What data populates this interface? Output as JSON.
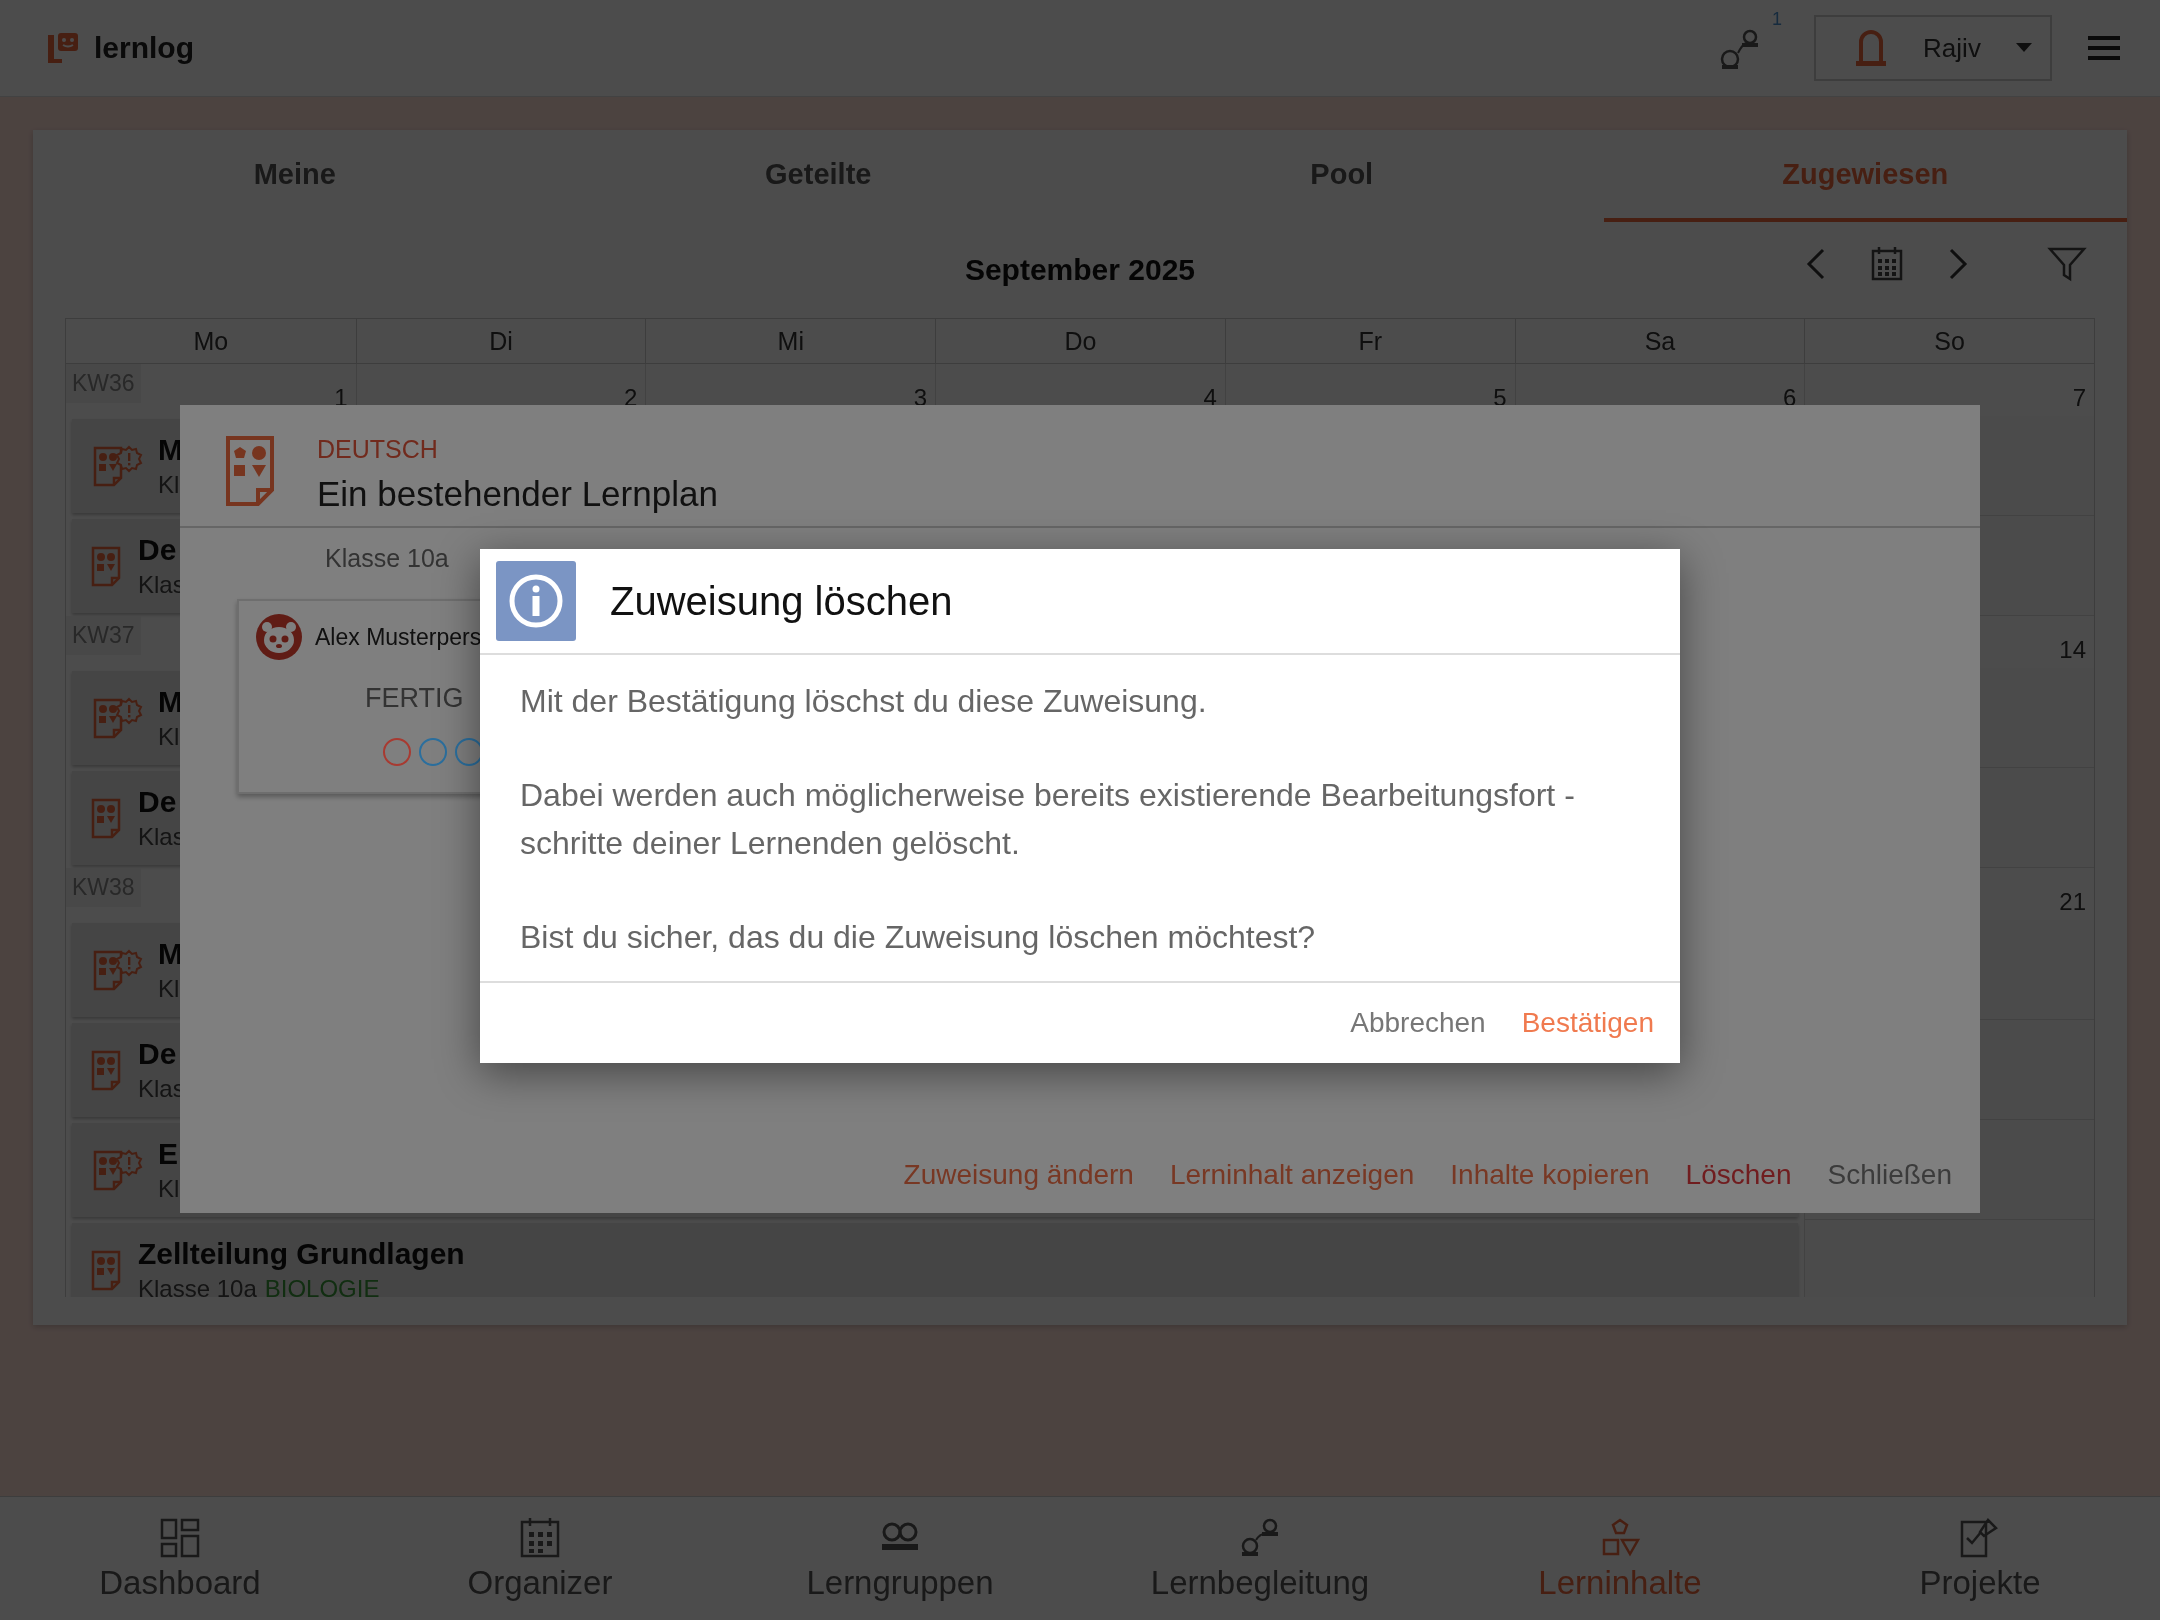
{
  "header": {
    "app_name": "lernlog",
    "notification_count": "1",
    "user": {
      "name": "Rajiv"
    }
  },
  "tabs": [
    {
      "label": "Meine",
      "selected": false
    },
    {
      "label": "Geteilte",
      "selected": false
    },
    {
      "label": "Pool",
      "selected": false
    },
    {
      "label": "Zugewiesen",
      "selected": true
    }
  ],
  "calendar": {
    "month": "September 2025",
    "weekdays": [
      "Mo",
      "Di",
      "Mi",
      "Do",
      "Fr",
      "Sa",
      "So"
    ],
    "weeks": [
      {
        "week": "KW36",
        "dates": [
          "1",
          "2",
          "3",
          "4",
          "5",
          "6",
          "7"
        ],
        "events": [
          {
            "kind": "warning",
            "title": "M",
            "subtitle": "Kl"
          },
          {
            "kind": "plan",
            "title": "De",
            "subtitle": "Klas"
          }
        ]
      },
      {
        "week": "KW37",
        "dates": [
          "14"
        ],
        "events": [
          {
            "kind": "warning",
            "title": "M",
            "subtitle": "Kl"
          },
          {
            "kind": "plan",
            "title": "De",
            "subtitle": "Klas"
          }
        ]
      },
      {
        "week": "KW38",
        "dates": [
          "21"
        ],
        "events": [
          {
            "kind": "warning",
            "title": "M",
            "subtitle": "Kl"
          },
          {
            "kind": "plan",
            "title": "De",
            "subtitle": "Klas"
          },
          {
            "kind": "warning",
            "title": "E",
            "subtitle": "Kl"
          },
          {
            "kind": "plan",
            "title": "Zellteilung Grundlagen",
            "subtitle": "Klasse 10a",
            "subject": "BIOLOGIE"
          }
        ]
      }
    ]
  },
  "detail": {
    "subject": "DEUTSCH",
    "title": "Ein bestehender Lernplan",
    "class": "Klasse 10a",
    "student": {
      "name": "Alex Musterpers",
      "status": "FERTIG",
      "progress": [
        {
          "color": "#a83a31"
        },
        {
          "color": "#2b6f9e"
        },
        {
          "color": "#2b6f9e"
        }
      ]
    },
    "actions": [
      {
        "label": "Zuweisung ändern",
        "kind": "link"
      },
      {
        "label": "Lerninhalt anzeigen",
        "kind": "link"
      },
      {
        "label": "Inhalte kopieren",
        "kind": "link"
      },
      {
        "label": "Löschen",
        "kind": "danger"
      },
      {
        "label": "Schließen",
        "kind": "close"
      }
    ]
  },
  "confirm": {
    "title": "Zuweisung löschen",
    "paragraphs": [
      "Mit der Bestätigung löschst du diese Zuweisung.",
      "Dabei werden auch möglicherweise bereits existierende Bearbeitungsfort -\nschritte deiner Lernenden gelöscht.",
      "Bist du sicher, das du die Zuweisung löschen möchtest?"
    ],
    "buttons": [
      {
        "label": "Abbrechen",
        "kind": "cancel"
      },
      {
        "label": "Bestätigen",
        "kind": "confirm"
      }
    ]
  },
  "bottom_nav": [
    {
      "label": "Dashboard",
      "selected": false
    },
    {
      "label": "Organizer",
      "selected": false
    },
    {
      "label": "Lerngruppen",
      "selected": false
    },
    {
      "label": "Lernbegleitung",
      "selected": false
    },
    {
      "label": "Lerninhalte",
      "selected": true
    },
    {
      "label": "Projekte",
      "selected": false
    }
  ]
}
